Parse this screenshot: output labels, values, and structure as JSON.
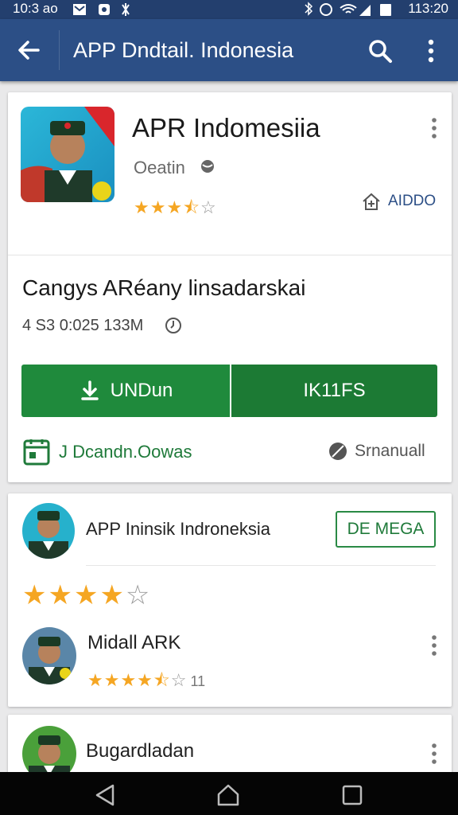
{
  "status_bar": {
    "left_time": "10:3 ao",
    "time": "113:20"
  },
  "app_bar": {
    "title": "APP Dndtail. Indonesia"
  },
  "app_card": {
    "name": "APR Indomesiia",
    "developer": "Oeatin",
    "rating_stars": 3.5,
    "add_label": "AIDDO",
    "tagline": "Cangys ARéany linsadarskai",
    "meta": "4 S3 0:025 133M",
    "install_label": "UNDun",
    "second_label": "IK11FS",
    "footer_left": "J Dcandn.Oowas",
    "footer_right": "Srnanuall",
    "colors": {
      "primary": "#2c4f86",
      "install": "#1f8a3c",
      "star": "#f5a623"
    }
  },
  "review_card": {
    "title": "APP Ininsik Indroneksia",
    "demo_label": "DE MEGA",
    "rating_stars": 4,
    "reviewer": {
      "name": "Midall ARK",
      "rating_stars": 4.5,
      "count": "11"
    }
  },
  "third_card": {
    "name": "Bugardladan"
  }
}
